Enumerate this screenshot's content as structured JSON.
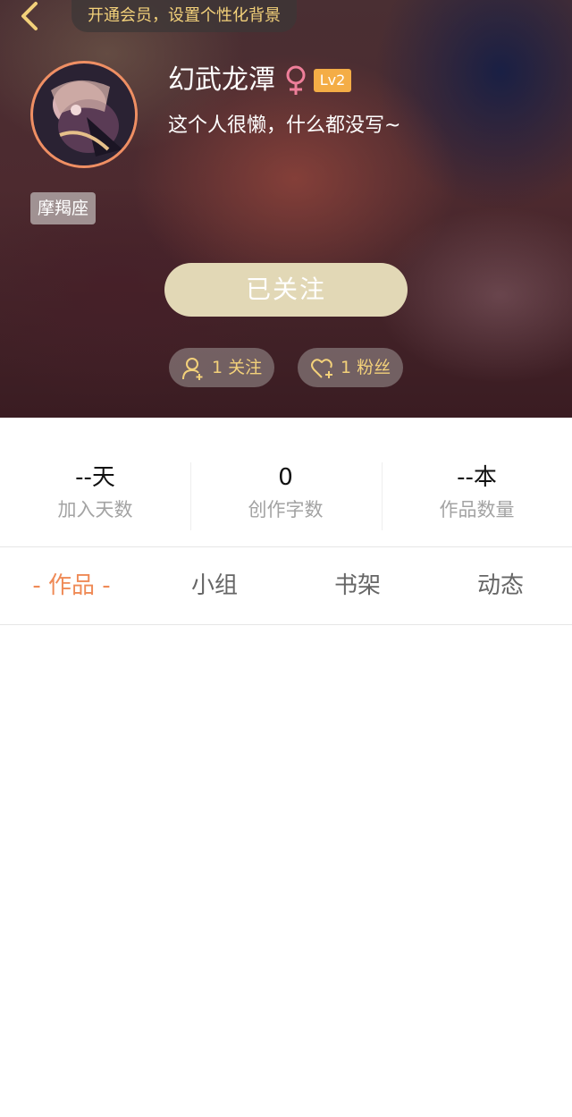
{
  "header": {
    "back_icon": "chevron-left-icon",
    "vip_banner": "开通会员，设置个性化背景"
  },
  "profile": {
    "username": "幻武龙潭",
    "gender_icon": "female-icon",
    "gender_color": "#ef7f9a",
    "level": "Lv2",
    "level_color": "#f4ad46",
    "signature": "这个人很懒，什么都没写~",
    "zodiac": "摩羯座",
    "avatar_border_color": "#ef8f63"
  },
  "follow_button": {
    "label": "已关注"
  },
  "social": {
    "following": "1 关注",
    "fans": "1 粉丝",
    "accent_color": "#f3d17a"
  },
  "stats": [
    {
      "value": "--天",
      "label": "加入天数"
    },
    {
      "value": "0",
      "label": "创作字数"
    },
    {
      "value": "--本",
      "label": "作品数量"
    }
  ],
  "tabs": [
    {
      "label": "- 作品 -",
      "active": true
    },
    {
      "label": "小组",
      "active": false
    },
    {
      "label": "书架",
      "active": false
    },
    {
      "label": "动态",
      "active": false
    }
  ],
  "colors": {
    "active_tab": "#ef8a56",
    "follow_button_bg": "#e2d8b6"
  }
}
